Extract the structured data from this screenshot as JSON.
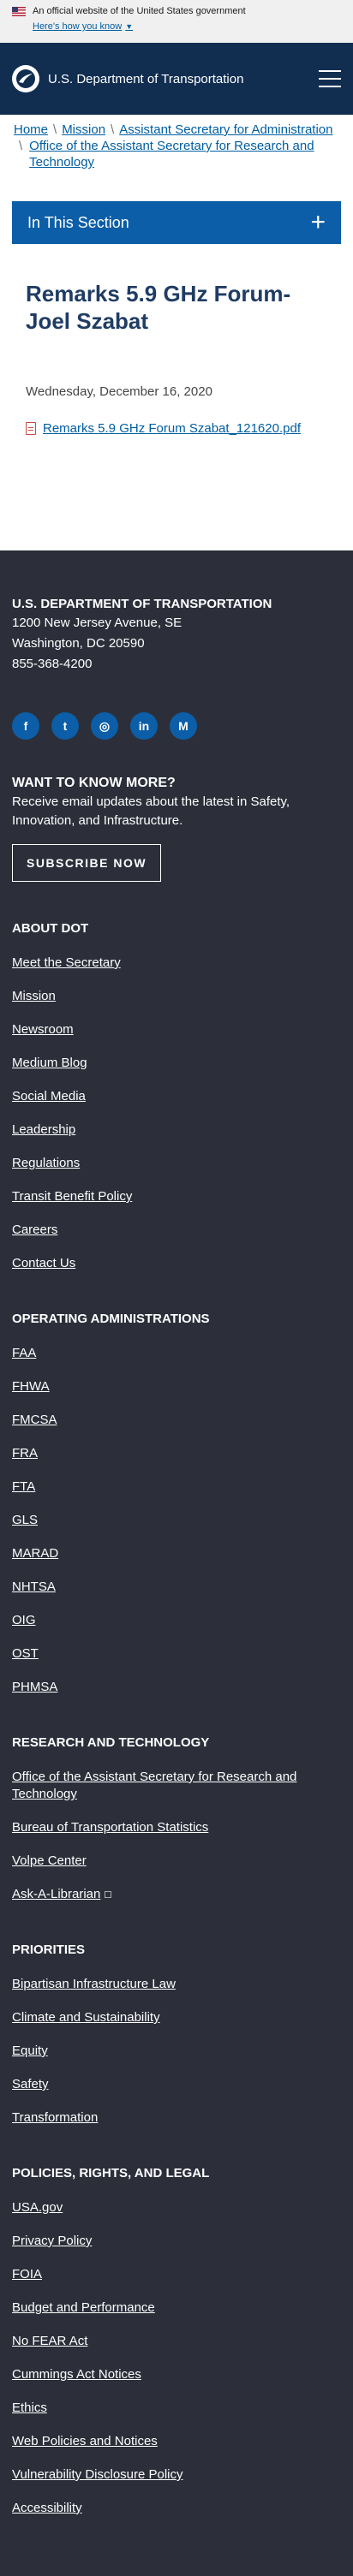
{
  "gov_banner": {
    "official_text": "An official website of the United States government",
    "howknow_label": "Here's how you know"
  },
  "header": {
    "site_name": "U.S. Department of Transportation"
  },
  "breadcrumb": [
    "Home",
    "Mission",
    "Assistant Secretary for Administration",
    "Office of the Assistant Secretary for Research and Technology"
  ],
  "section_nav": {
    "label": "In This Section",
    "toggle": "+"
  },
  "page": {
    "title": "Remarks 5.9 GHz Forum-Joel Szabat",
    "date": "Wednesday, December 16, 2020",
    "file_name": "Remarks 5.9 GHz Forum Szabat_121620.pdf"
  },
  "footer": {
    "org_name": "U.S. DEPARTMENT OF TRANSPORTATION",
    "address_line1": "1200 New Jersey Avenue, SE",
    "address_line2": "Washington, DC 20590",
    "phone": "855-368-4200",
    "socials": [
      {
        "name": "facebook-icon",
        "glyph": "f"
      },
      {
        "name": "twitter-icon",
        "glyph": "t"
      },
      {
        "name": "instagram-icon",
        "glyph": "◎"
      },
      {
        "name": "linkedin-icon",
        "glyph": "in"
      },
      {
        "name": "medium-icon",
        "glyph": "M"
      }
    ],
    "want": {
      "title": "WANT TO KNOW MORE?",
      "text": "Receive email updates about the latest in Safety, Innovation, and Infrastructure.",
      "button": "SUBSCRIBE NOW"
    },
    "sections": [
      {
        "title": "ABOUT DOT",
        "links": [
          "Meet the Secretary",
          "Mission",
          "Newsroom",
          "Medium Blog",
          "Social Media",
          "Leadership",
          "Regulations",
          "Transit Benefit Policy",
          "Careers",
          "Contact Us"
        ]
      },
      {
        "title": "OPERATING ADMINISTRATIONS",
        "links": [
          "FAA",
          "FHWA",
          "FMCSA",
          "FRA",
          "FTA",
          "GLS",
          "MARAD",
          "NHTSA",
          "OIG",
          "OST",
          "PHMSA"
        ]
      },
      {
        "title": "RESEARCH AND TECHNOLOGY",
        "links": [
          "Office of the Assistant Secretary for Research and Technology",
          "Bureau of Transportation Statistics",
          "Volpe Center",
          "Ask-A-Librarian"
        ]
      },
      {
        "title": "PRIORITIES",
        "links": [
          "Bipartisan Infrastructure Law",
          "Climate and Sustainability",
          "Equity",
          "Safety",
          "Transformation"
        ]
      },
      {
        "title": "POLICIES, RIGHTS, AND LEGAL",
        "links": [
          "USA.gov",
          "Privacy Policy",
          "FOIA",
          "Budget and Performance",
          "No FEAR Act",
          "Cummings Act Notices",
          "Ethics",
          "Web Policies and Notices",
          "Vulnerability Disclosure Policy",
          "Accessibility"
        ]
      }
    ]
  }
}
